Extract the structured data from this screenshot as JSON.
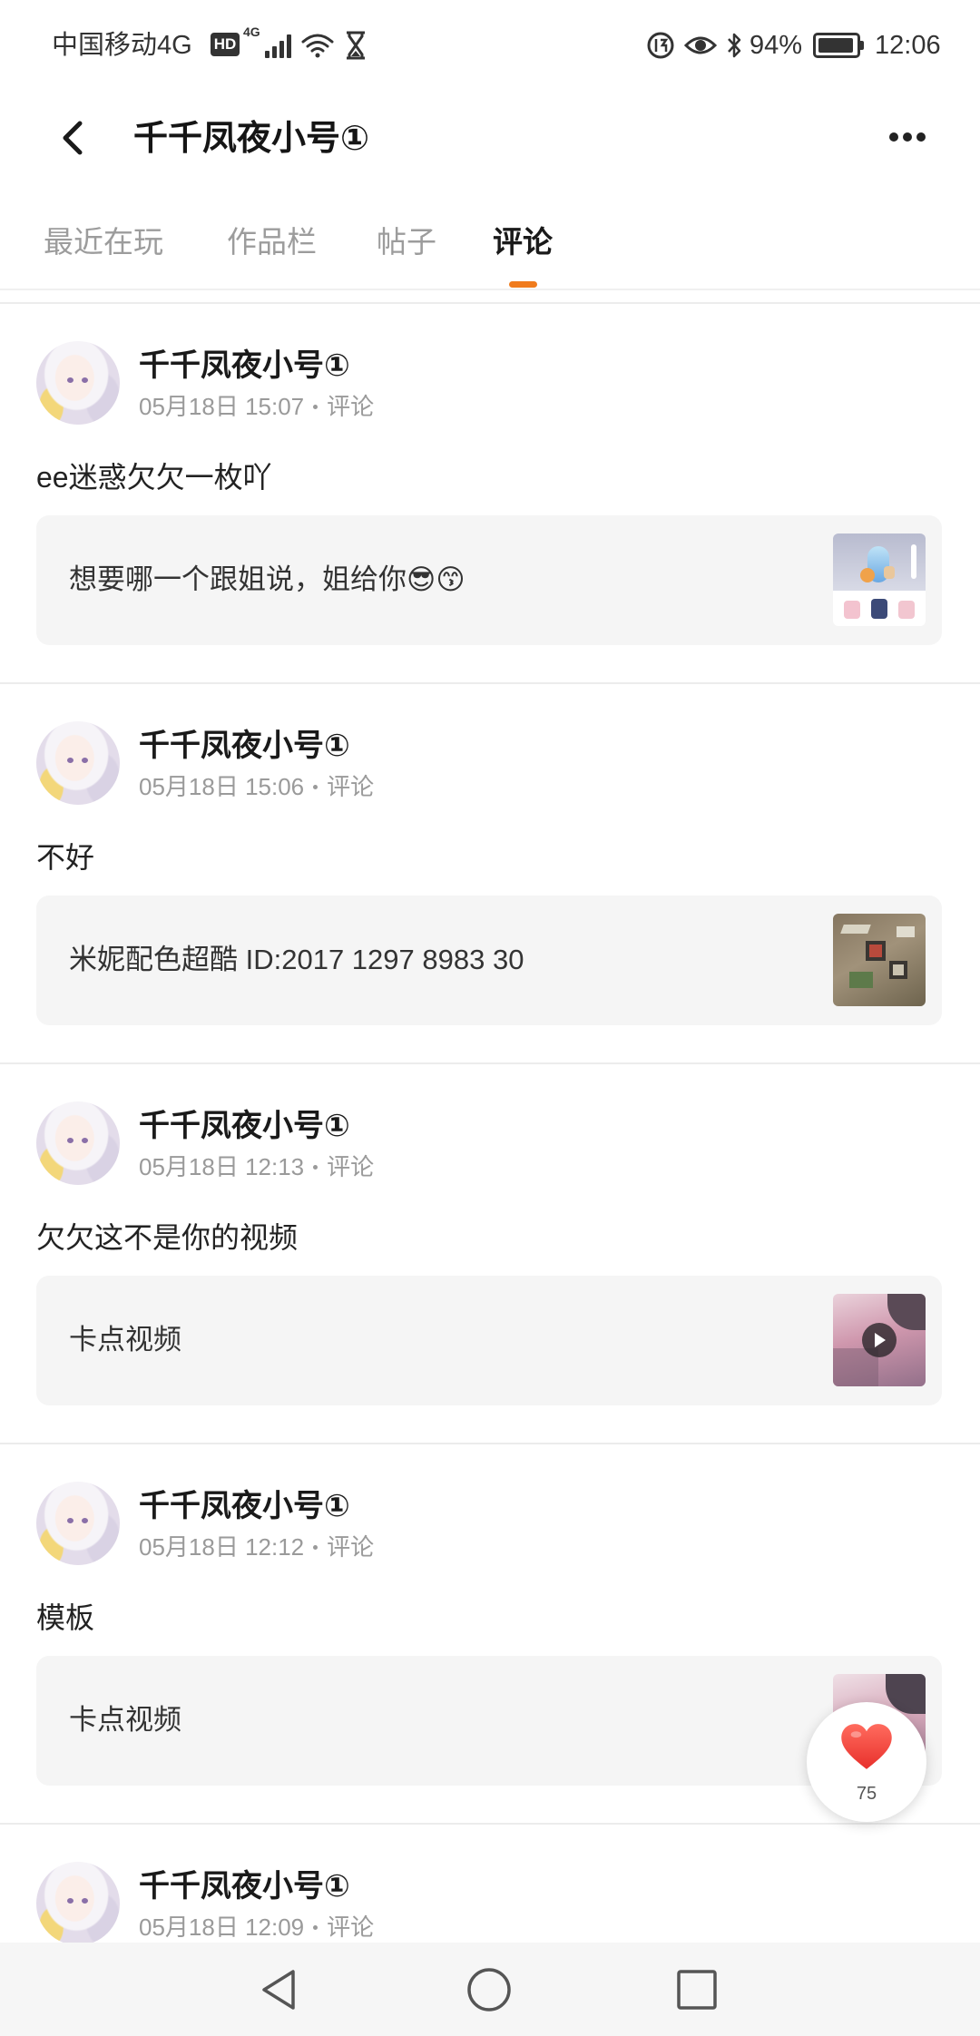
{
  "status_bar": {
    "carrier": "中国移动4G",
    "hd_badge": "HD",
    "network": "4G",
    "battery": "94%",
    "time": "12:06",
    "icons": [
      "signal-icon",
      "wifi-icon",
      "hourglass-icon",
      "app-notification-icon",
      "eye-icon",
      "bluetooth-icon",
      "battery-icon"
    ]
  },
  "header": {
    "title": "千千凤夜小号①",
    "icons": [
      "back-arrow-icon",
      "more-dots-icon"
    ]
  },
  "tabs": [
    {
      "label": "最近在玩",
      "active": false
    },
    {
      "label": "作品栏",
      "active": false
    },
    {
      "label": "帖子",
      "active": false
    },
    {
      "label": "评论",
      "active": true
    }
  ],
  "comments": [
    {
      "author": "千千凤夜小号①",
      "time": "05月18日 15:07",
      "type": "评论",
      "text": "ee迷惑欠欠一枚吖",
      "quote": "想要哪一个跟姐说，姐给你😎😙"
    },
    {
      "author": "千千凤夜小号①",
      "time": "05月18日 15:06",
      "type": "评论",
      "text": "不好",
      "quote": "米妮配色超酷 ID:2017 1297 8983 30"
    },
    {
      "author": "千千凤夜小号①",
      "time": "05月18日 12:13",
      "type": "评论",
      "text": "欠欠这不是你的视频",
      "quote": "卡点视频",
      "thumbnail_icon": "play-icon"
    },
    {
      "author": "千千凤夜小号①",
      "time": "05月18日 12:12",
      "type": "评论",
      "text": "模板",
      "quote": "卡点视频"
    },
    {
      "author": "千千凤夜小号①",
      "time": "05月18日 12:09",
      "type": "评论"
    }
  ],
  "like_button": {
    "count": "75",
    "icon": "heart-icon"
  },
  "nav_bar": {
    "icons": [
      "back-triangle-icon",
      "home-circle-icon",
      "recents-square-icon"
    ]
  },
  "colors": {
    "accent": "#f07b1c",
    "heart": "#f2473b",
    "text_secondary": "#9a9a9a",
    "quote_bg": "#f5f5f5"
  }
}
